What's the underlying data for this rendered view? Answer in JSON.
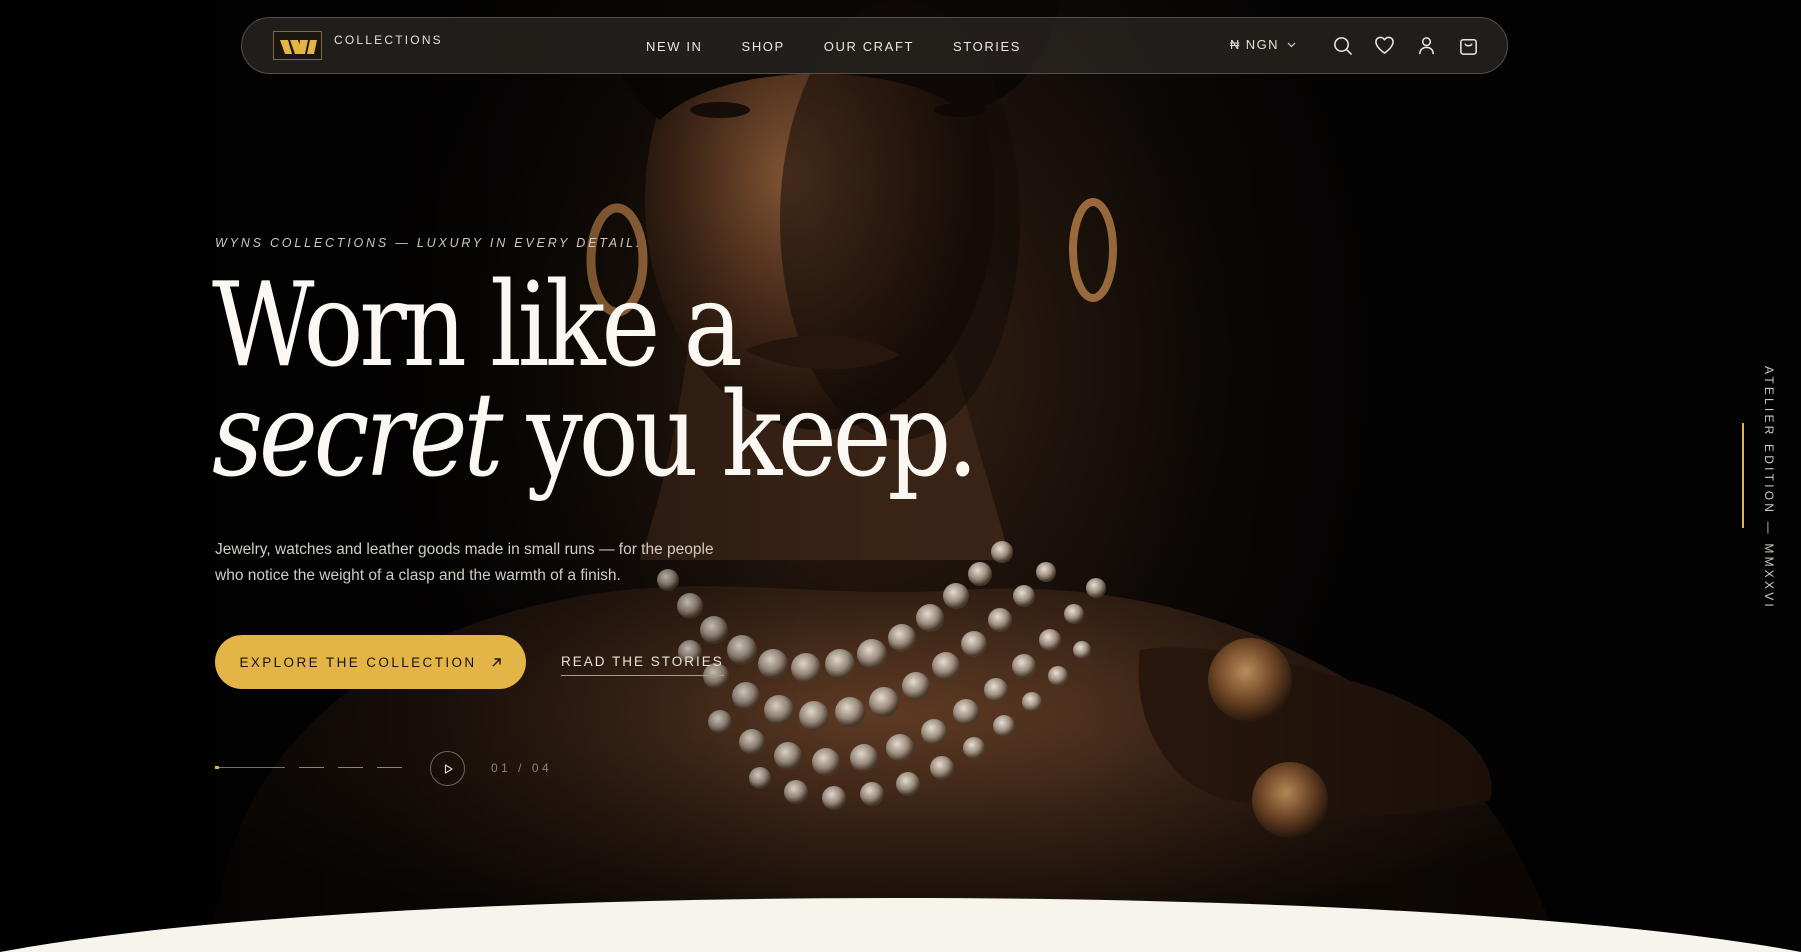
{
  "brand": {
    "logo_text": "COLLECTIONS"
  },
  "nav": {
    "links": [
      "NEW IN",
      "SHOP",
      "OUR CRAFT",
      "STORIES"
    ],
    "currency": "₦ NGN"
  },
  "hero": {
    "eyebrow": "WYNS COLLECTIONS — LUXURY IN EVERY DETAIL.",
    "headline_line1": "Worn like a",
    "headline_italic": "secret",
    "headline_rest": "you keep.",
    "subcopy": "Jewelry, watches and leather goods made in small runs — for the people who notice the weight of a clasp and the warmth of a finish.",
    "cta_label": "EXPLORE THE COLLECTION",
    "secondary_label": "READ THE STORIES"
  },
  "slider": {
    "counter": "01 / 04",
    "current": 1,
    "total": 4
  },
  "side_label": "ATELIER EDITION — MMXXVI",
  "colors": {
    "accent": "#e3b547",
    "cream": "#f7f4ec",
    "ink": "#050404"
  }
}
